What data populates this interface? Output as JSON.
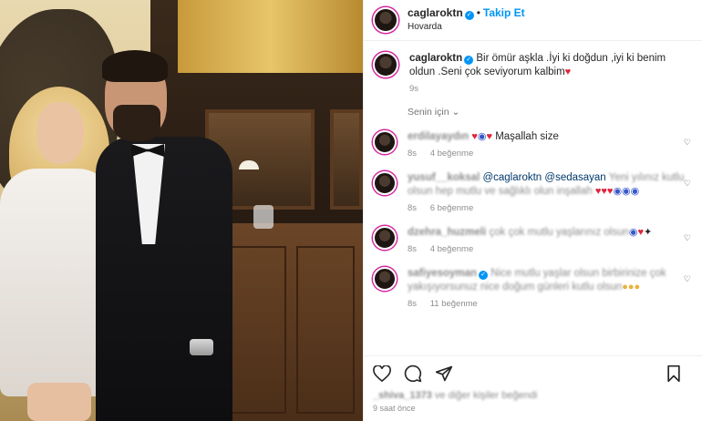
{
  "header": {
    "username": "caglaroktn",
    "follow_label": "Takip Et",
    "location": "Hovarda"
  },
  "caption": {
    "username": "caglaroktn",
    "text": "Bir ömür aşkla .İyi ki doğdun ,iyi ki benim oldun .Seni çok seviyorum kalbim",
    "time": "9s"
  },
  "filter_label": "Senin için",
  "comments": [
    {
      "username": "erdilayaydın",
      "text": "Maşallah size",
      "time": "8s",
      "likes": "4 beğenme"
    },
    {
      "username": "yusuf__koksal",
      "mentions": "@caglaroktn @sedasayan",
      "text": "Yeni yılınız kutlu olsun hep mutlu ve sağlıklı olun inşallah",
      "time": "8s",
      "likes": "6 beğenme"
    },
    {
      "username": "dzehra_huzmeli",
      "text": "çok çok mutlu yaşlarınız olsun",
      "time": "8s",
      "likes": "4 beğenme"
    },
    {
      "username": "safiyesoyman",
      "text": "Nice mutlu yaşlar olsun birbirinize çok yakışıyorsunuz nice doğum günleri kutlu olsun",
      "time": "8s",
      "likes": "11 beğenme"
    }
  ],
  "footer": {
    "likes_user": "_shiva_1373",
    "likes_text": "ve diğer kişiler beğendi",
    "ago": "9 saat önce"
  },
  "colors": {
    "accent": "#0095f6",
    "text": "#262626",
    "muted": "#8e8e8e"
  },
  "icons": [
    "heart-icon",
    "comment-icon",
    "share-icon",
    "bookmark-icon",
    "verified-icon",
    "chevron-down-icon"
  ]
}
